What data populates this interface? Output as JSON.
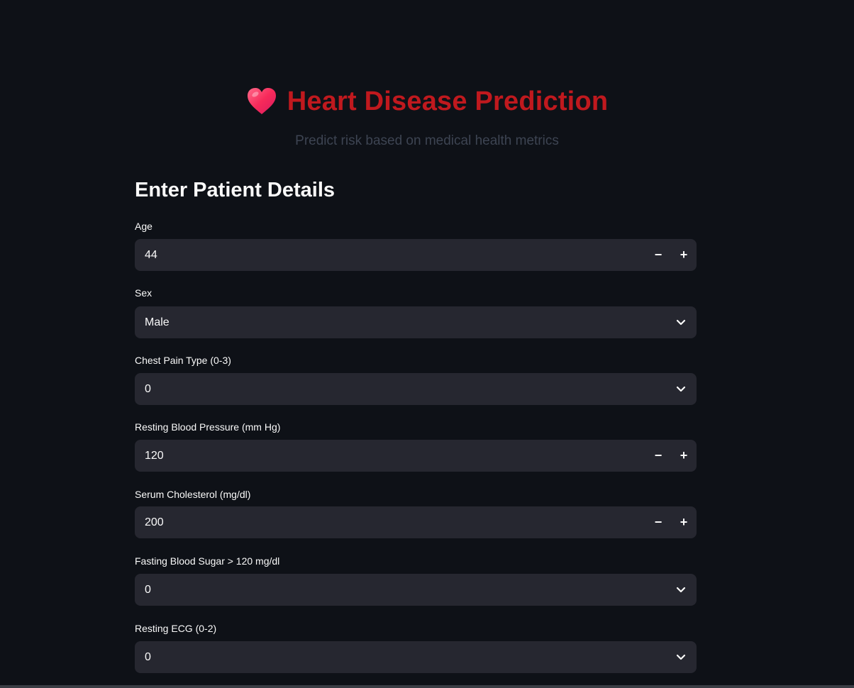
{
  "header": {
    "icon": "heart-icon",
    "title": "Heart Disease Prediction",
    "subtitle": "Predict risk based on medical health metrics"
  },
  "form": {
    "section_title": "Enter Patient Details",
    "fields": [
      {
        "label": "Age",
        "type": "number",
        "value": "44"
      },
      {
        "label": "Sex",
        "type": "select",
        "value": "Male"
      },
      {
        "label": "Chest Pain Type (0-3)",
        "type": "select",
        "value": "0"
      },
      {
        "label": "Resting Blood Pressure (mm Hg)",
        "type": "number",
        "value": "120"
      },
      {
        "label": "Serum Cholesterol (mg/dl)",
        "type": "number",
        "value": "200"
      },
      {
        "label": "Fasting Blood Sugar > 120 mg/dl",
        "type": "select",
        "value": "0"
      },
      {
        "label": "Resting ECG (0-2)",
        "type": "select",
        "value": "0"
      }
    ],
    "stepper": {
      "minus": "−",
      "plus": "+"
    }
  },
  "colors": {
    "background": "#0e1117",
    "title": "#c0191e",
    "input_bg": "#262730",
    "text": "#fafafa",
    "subtitle": "#3d4452"
  }
}
